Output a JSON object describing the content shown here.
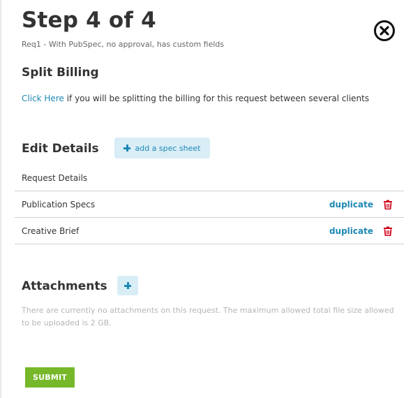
{
  "header": {
    "title": "Step 4 of 4",
    "subtitle": "Req1 - With PubSpec, no approval, has custom fields"
  },
  "split_billing": {
    "title": "Split Billing",
    "link_label": "Click Here",
    "description": " if you will be splitting the billing for this request between several clients"
  },
  "edit_details": {
    "title": "Edit Details",
    "add_spec_label": "add a spec sheet",
    "rows": [
      {
        "label": "Request Details",
        "duplicate": ""
      },
      {
        "label": "Publication Specs",
        "duplicate": "duplicate"
      },
      {
        "label": "Creative Brief",
        "duplicate": "duplicate"
      }
    ]
  },
  "attachments": {
    "title": "Attachments",
    "note": "There are currently no attachments on this request. The maximum allowed total file size allowed to be uploaded is 2 GB."
  },
  "submit_label": "SUBMIT",
  "colors": {
    "link": "#1e88b4",
    "button_light": "#d9edf7",
    "submit": "#76b82a",
    "trash": "#d0021b"
  },
  "icons": [
    "close-icon",
    "plus-icon",
    "trash-icon"
  ]
}
